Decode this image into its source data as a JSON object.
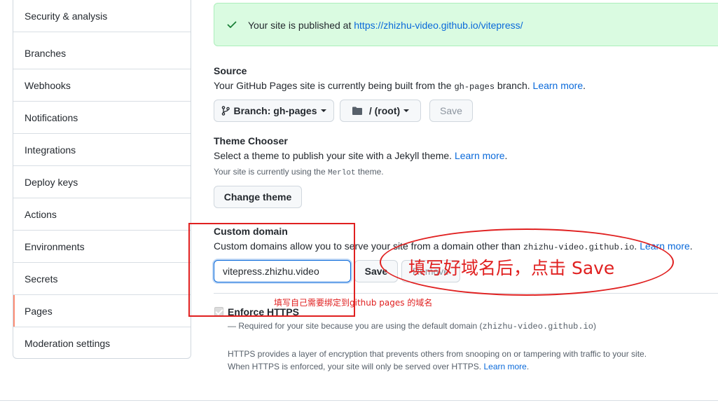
{
  "sidebar": {
    "items": [
      {
        "label": "Security & analysis"
      },
      {
        "label": "Branches"
      },
      {
        "label": "Webhooks"
      },
      {
        "label": "Notifications"
      },
      {
        "label": "Integrations"
      },
      {
        "label": "Deploy keys"
      },
      {
        "label": "Actions"
      },
      {
        "label": "Environments"
      },
      {
        "label": "Secrets"
      },
      {
        "label": "Pages",
        "active": true
      },
      {
        "label": "Moderation settings"
      }
    ]
  },
  "flash": {
    "text": "Your site is published at ",
    "url": "https://zhizhu-video.github.io/vitepress/",
    "icon": "check-icon",
    "color": "#1a7f37"
  },
  "source": {
    "heading": "Source",
    "desc_before": "Your GitHub Pages site is currently being built from the ",
    "branch_code": "gh-pages",
    "desc_after": " branch. ",
    "learn_more": "Learn more",
    "period": ".",
    "branch_button": "Branch: gh-pages",
    "folder_button": "/ (root)",
    "save_button": "Save"
  },
  "theme": {
    "heading": "Theme Chooser",
    "desc": "Select a theme to publish your site with a Jekyll theme. ",
    "learn_more": "Learn more",
    "period": ".",
    "current_before": "Your site is currently using the ",
    "current_theme": "Merlot",
    "current_after": " theme.",
    "change_button": "Change theme"
  },
  "custom_domain": {
    "heading": "Custom domain",
    "desc": "Custom domains allow you to serve your site from a domain other than ",
    "domain_code": "zhizhu-video.github.io",
    "period_before_link": ". ",
    "learn_more": "Learn more",
    "period": ".",
    "input_value": "vitepress.zhizhu.video",
    "save_button": "Save",
    "remove_button": "Remove"
  },
  "https": {
    "label": "Enforce HTTPS",
    "required_before": "— Required for your site because you are using the default domain (",
    "required_domain": "zhizhu-video.github.io",
    "required_after": ")",
    "info_line1": "HTTPS provides a layer of encryption that prevents others from snooping on or tampering with traffic to your site.",
    "info_line2_before": "When HTTPS is enforced, your site will only be served over HTTPS. ",
    "learn_more": "Learn more",
    "period": "."
  },
  "annotations": {
    "big": "填写好域名后，点击 Save",
    "small": "填写自己需要绑定到github pages 的域名",
    "color": "#e02020"
  }
}
